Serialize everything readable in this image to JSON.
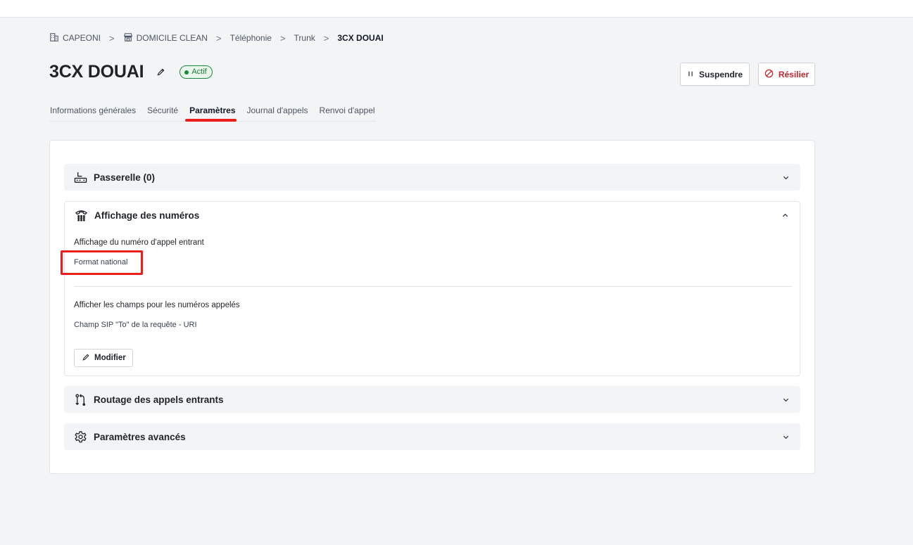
{
  "breadcrumb": {
    "items": [
      {
        "label": "CAPEONI",
        "icon": "building-icon"
      },
      {
        "label": "DOMICILE CLEAN",
        "icon": "store-icon"
      },
      {
        "label": "Téléphonie"
      },
      {
        "label": "Trunk"
      },
      {
        "label": "3CX DOUAI"
      }
    ],
    "separator": ">"
  },
  "header": {
    "title": "3CX DOUAI",
    "status": "Actif",
    "status_color": "#1a8a3a",
    "suspend_label": "Suspendre",
    "resilier_label": "Résilier",
    "danger_color": "#c0262d"
  },
  "tabs": [
    {
      "label": "Informations générales",
      "active": false
    },
    {
      "label": "Sécurité",
      "active": false
    },
    {
      "label": "Paramètres",
      "active": true
    },
    {
      "label": "Journal d'appels",
      "active": false
    },
    {
      "label": "Renvoi d'appel",
      "active": false
    }
  ],
  "sections": {
    "passerelle": {
      "title": "Passerelle (0)",
      "icon": "gateway-icon",
      "expanded": false
    },
    "affichage": {
      "title": "Affichage des numéros",
      "icon": "phone-dialpad-icon",
      "expanded": true,
      "field1_label": "Affichage du numéro d'appel entrant",
      "field1_value": "Format national",
      "field2_label": "Afficher les champs pour les numéros appelés",
      "field2_value": "Champ SIP \"To\" de la requête - URI",
      "modify_label": "Modifier"
    },
    "routage": {
      "title": "Routage des appels entrants",
      "icon": "routing-arrows-icon",
      "expanded": false
    },
    "avances": {
      "title": "Paramètres avancés",
      "icon": "gear-icon",
      "expanded": false
    }
  },
  "annotation_color": "#ea1e1e"
}
